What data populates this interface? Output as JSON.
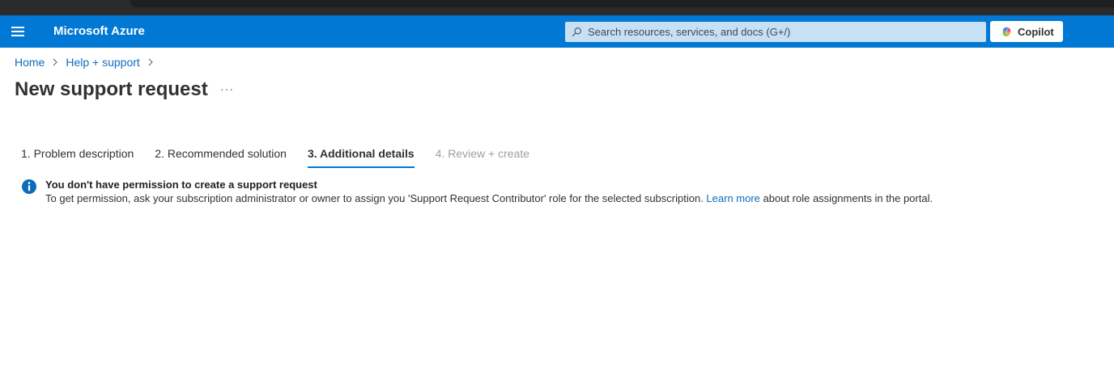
{
  "header": {
    "brand": "Microsoft Azure",
    "search_placeholder": "Search resources, services, and docs (G+/)",
    "copilot_label": "Copilot",
    "bar_color": "#0078d4"
  },
  "breadcrumb": {
    "items": [
      "Home",
      "Help + support"
    ]
  },
  "page": {
    "title": "New support request",
    "more_label": "···"
  },
  "tabs": [
    {
      "label": "1. Problem description",
      "state": "normal"
    },
    {
      "label": "2. Recommended solution",
      "state": "normal"
    },
    {
      "label": "3. Additional details",
      "state": "active"
    },
    {
      "label": "4. Review + create",
      "state": "disabled"
    }
  ],
  "notice": {
    "icon": "info-icon",
    "heading": "You don't have permission to create a support request",
    "body_before": "To get permission, ask your subscription administrator or owner to assign you 'Support Request Contributor' role for the selected subscription. ",
    "link_text": "Learn more",
    "body_after": " about role assignments in the portal."
  }
}
